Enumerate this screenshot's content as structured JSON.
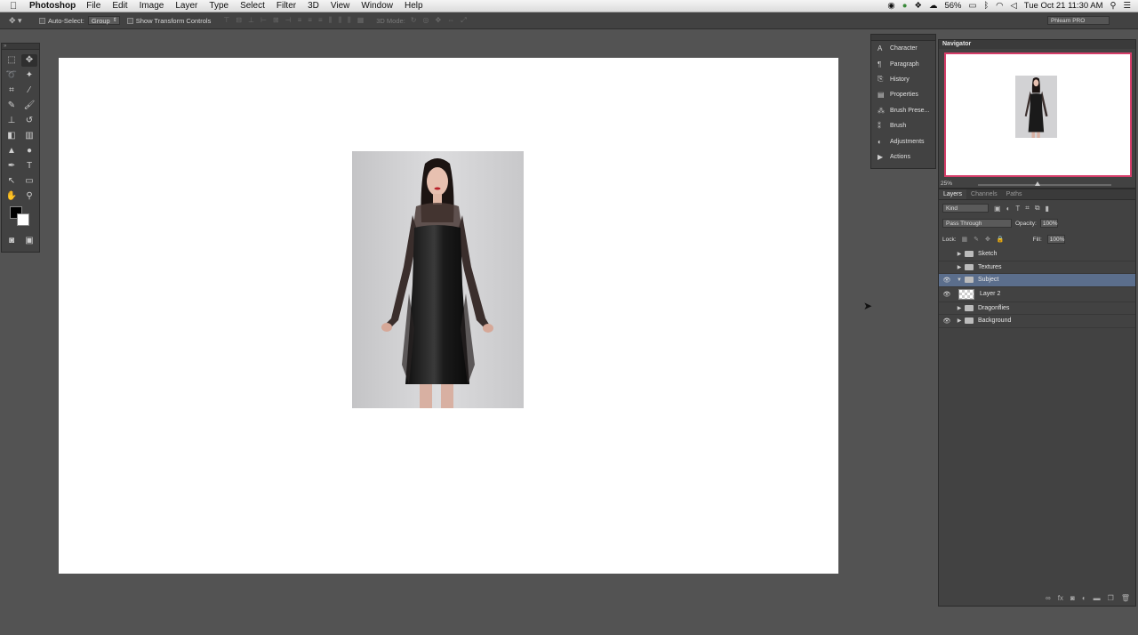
{
  "menubar": {
    "app_name": "Photoshop",
    "menus": [
      "File",
      "Edit",
      "Image",
      "Layer",
      "Type",
      "Select",
      "Filter",
      "3D",
      "View",
      "Window",
      "Help"
    ],
    "battery": "56%",
    "datetime": "Tue Oct 21  11:30 AM"
  },
  "options": {
    "auto_select_label": "Auto-Select:",
    "auto_select_value": "Group",
    "transform_label": "Show Transform Controls",
    "mode3d_label": "3D Mode:",
    "workspace": "Phlearn PRO"
  },
  "dock": {
    "items": [
      {
        "label": "Character",
        "icon": "character-icon"
      },
      {
        "label": "Paragraph",
        "icon": "paragraph-icon"
      },
      {
        "label": "History",
        "icon": "history-icon"
      },
      {
        "label": "Properties",
        "icon": "properties-icon"
      },
      {
        "label": "Brush Prese...",
        "icon": "brush-presets-icon"
      },
      {
        "label": "Brush",
        "icon": "brush-icon"
      },
      {
        "label": "Adjustments",
        "icon": "adjustments-icon"
      },
      {
        "label": "Actions",
        "icon": "actions-icon"
      }
    ]
  },
  "navigator": {
    "title": "Navigator",
    "zoom": "25%",
    "view_box_color": "#d63e6a"
  },
  "layers_panel": {
    "tabs": [
      "Layers",
      "Channels",
      "Paths"
    ],
    "kind_filter": "Kind",
    "blend_mode": "Pass Through",
    "opacity_label": "Opacity:",
    "opacity_value": "100%",
    "lock_label": "Lock:",
    "fill_label": "Fill:",
    "fill_value": "100%",
    "selected_color": "#5b6e8c",
    "layers": [
      {
        "name": "Sketch",
        "type": "group",
        "visible": false,
        "expanded": false
      },
      {
        "name": "Textures",
        "type": "group",
        "visible": false,
        "expanded": false
      },
      {
        "name": "Subject",
        "type": "group",
        "visible": true,
        "expanded": true,
        "selected": true
      },
      {
        "name": "Layer 2",
        "type": "layer",
        "visible": true
      },
      {
        "name": "Dragonflies",
        "type": "group",
        "visible": false,
        "expanded": false
      },
      {
        "name": "Background",
        "type": "group",
        "visible": true,
        "expanded": false
      }
    ]
  }
}
